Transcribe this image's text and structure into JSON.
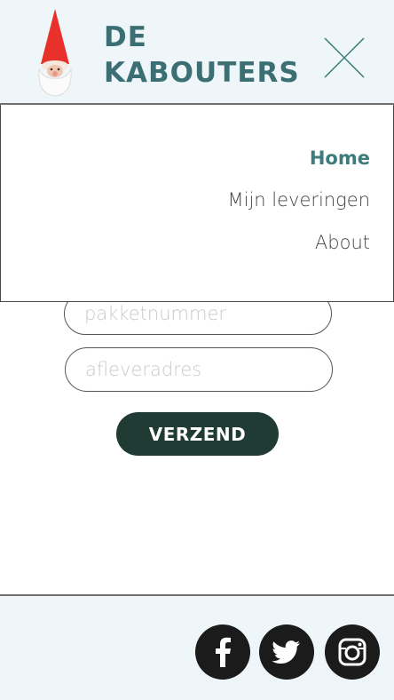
{
  "header": {
    "brand_line1": "DE",
    "brand_line2": "KABOUTERS"
  },
  "menu": {
    "items": [
      {
        "label": "Home",
        "active": true
      },
      {
        "label": "Mijn leveringen",
        "active": false
      },
      {
        "label": "About",
        "active": false
      }
    ]
  },
  "form": {
    "package_placeholder": "pakketnummer",
    "address_placeholder": "afleveradres",
    "submit_label": "VERZEND"
  },
  "footer": {
    "social": [
      "facebook-icon",
      "twitter-icon",
      "instagram-icon"
    ]
  },
  "colors": {
    "header_bg": "#eff6fa",
    "brand": "#3c6f73",
    "active_menu": "#3e7b7b",
    "button": "#1f3b33"
  }
}
